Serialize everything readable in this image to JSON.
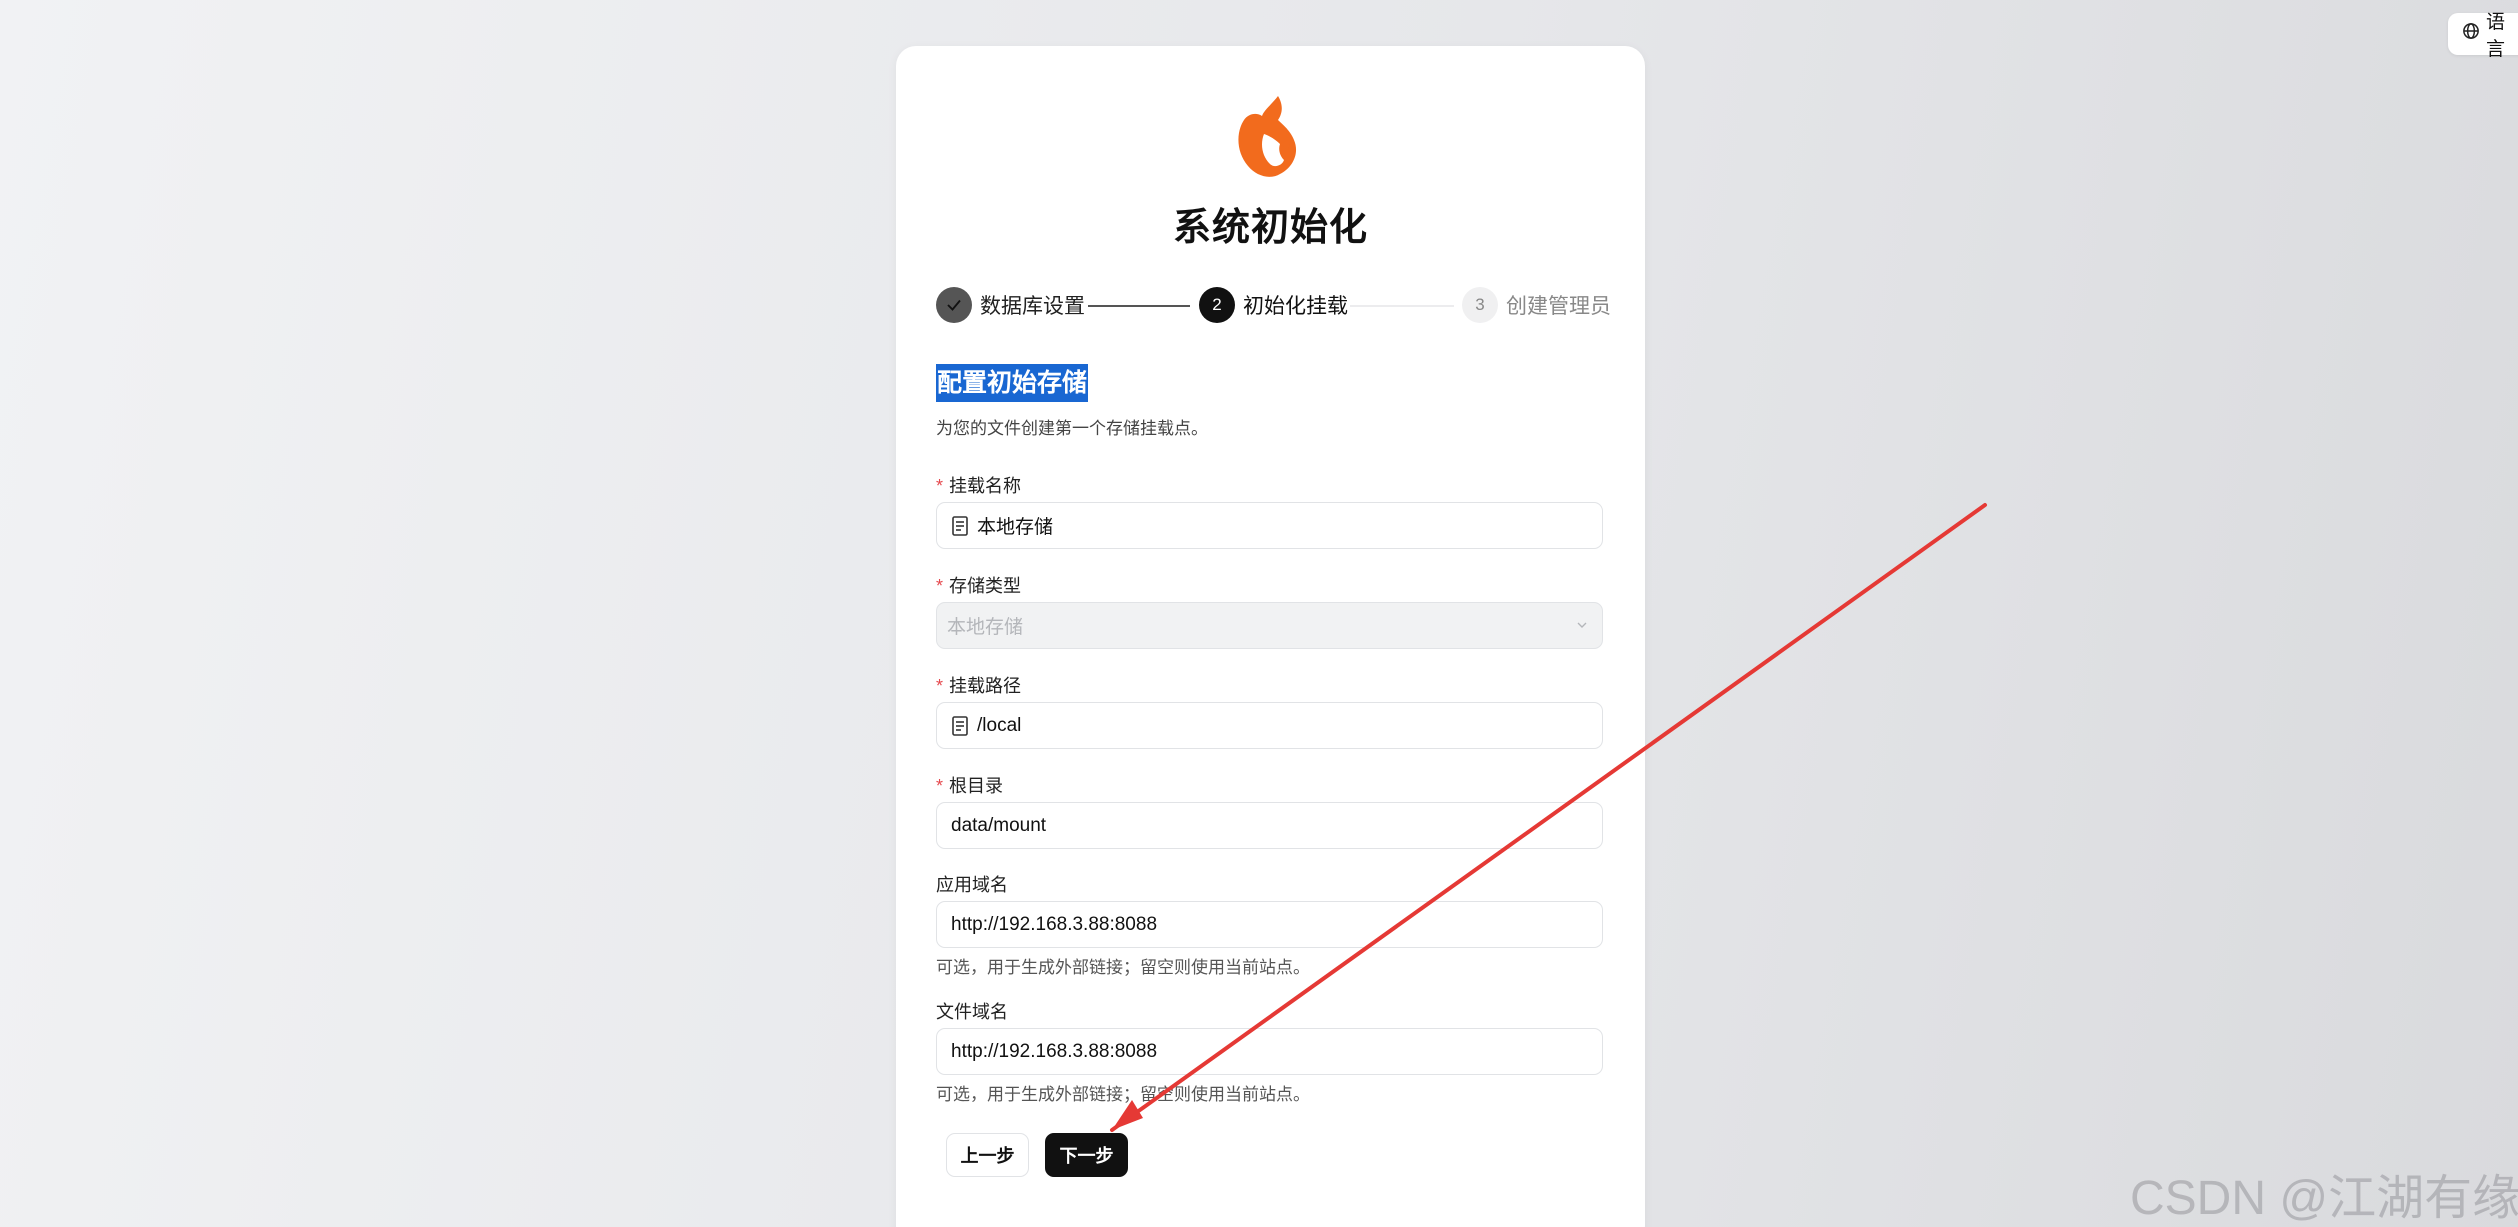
{
  "language_button": {
    "label": "语言"
  },
  "page": {
    "title": "系统初始化",
    "logo": "fox-logo",
    "accent_color": "#f26b1d"
  },
  "steps": [
    {
      "number": "✓",
      "label": "数据库设置",
      "state": "done"
    },
    {
      "number": "2",
      "label": "初始化挂载",
      "state": "active"
    },
    {
      "number": "3",
      "label": "创建管理员",
      "state": "pending"
    }
  ],
  "section": {
    "title": "配置初始存储",
    "subtitle": "为您的文件创建第一个存储挂载点。"
  },
  "form": {
    "mount_name": {
      "label": "挂载名称",
      "required": true,
      "value": "本地存储",
      "icon": "file-icon"
    },
    "storage_type": {
      "label": "存储类型",
      "required": true,
      "value": "本地存储",
      "disabled": true
    },
    "mount_path": {
      "label": "挂载路径",
      "required": true,
      "value": "/local",
      "icon": "file-icon"
    },
    "root_dir": {
      "label": "根目录",
      "required": true,
      "value": "data/mount"
    },
    "app_domain": {
      "label": "应用域名",
      "required": false,
      "value": "http://192.168.3.88:8088",
      "help": "可选，用于生成外部链接；留空则使用当前站点。"
    },
    "file_domain": {
      "label": "文件域名",
      "required": false,
      "value": "http://192.168.3.88:8088",
      "help": "可选，用于生成外部链接；留空则使用当前站点。"
    }
  },
  "buttons": {
    "prev": "上一步",
    "next": "下一步"
  },
  "annotation": {
    "arrow_color": "#e53935"
  },
  "watermark": "CSDN @江湖有缘"
}
